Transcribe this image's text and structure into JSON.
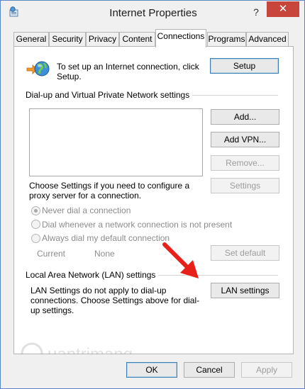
{
  "window": {
    "title": "Internet Properties",
    "help_label": "?",
    "close_label": "✕",
    "icon": "internet-options-icon"
  },
  "tabs": [
    {
      "label": "General"
    },
    {
      "label": "Security"
    },
    {
      "label": "Privacy"
    },
    {
      "label": "Content"
    },
    {
      "label": "Connections",
      "active": true
    },
    {
      "label": "Programs"
    },
    {
      "label": "Advanced"
    }
  ],
  "setup": {
    "text": "To set up an Internet connection, click Setup.",
    "button": "Setup",
    "icon": "globe-network-icon"
  },
  "dialup": {
    "section_label": "Dial-up and Virtual Private Network settings",
    "add_button": "Add...",
    "add_vpn_button": "Add VPN...",
    "remove_button": "Remove...",
    "settings_text": "Choose Settings if you need to configure a proxy server for a connection.",
    "settings_button": "Settings",
    "radios": [
      {
        "label": "Never dial a connection",
        "checked": true
      },
      {
        "label": "Dial whenever a network connection is not present",
        "checked": false
      },
      {
        "label": "Always dial my default connection",
        "checked": false
      }
    ],
    "current_label": "Current",
    "current_value": "None",
    "set_default_button": "Set default"
  },
  "lan": {
    "section_label": "Local Area Network (LAN) settings",
    "text": "LAN Settings do not apply to dial-up connections. Choose Settings above for dial-up settings.",
    "button": "LAN settings",
    "arrow_color": "#e8201a"
  },
  "footer": {
    "ok": "OK",
    "cancel": "Cancel",
    "apply": "Apply"
  },
  "watermark": "quantrimang",
  "colors": {
    "accent": "#3c7fb1",
    "close": "#c7453a",
    "disabled_text": "#9d9d9d"
  }
}
